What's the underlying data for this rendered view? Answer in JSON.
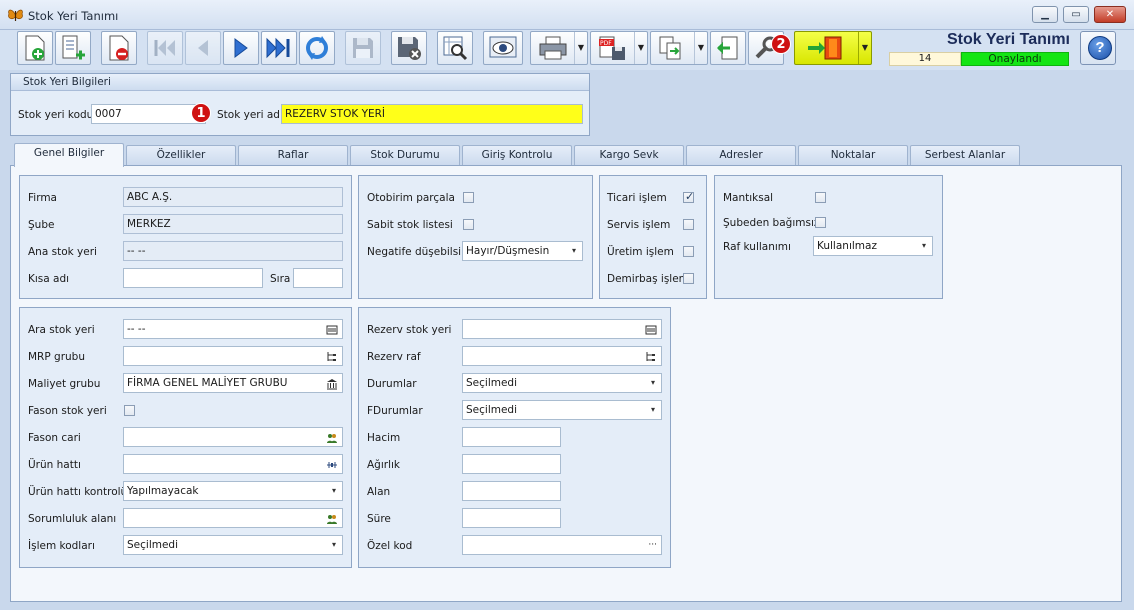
{
  "window": {
    "title": "Stok Yeri Tanımı"
  },
  "header": {
    "heading": "Stok Yeri Tanımı",
    "record_number": "14",
    "status": "Onaylandı",
    "status_color": "#14e514",
    "badges": [
      "1",
      "2"
    ]
  },
  "toolbar": {
    "buttons": [
      "new-document-icon",
      "new-list-icon",
      "delete-document-icon",
      "first-record-icon",
      "previous-record-icon",
      "next-record-icon",
      "last-record-icon",
      "refresh-icon",
      "save-icon",
      "save-cancel-icon",
      "search-icon",
      "preview-icon",
      "print-icon",
      "pdf-export-icon",
      "copy-icon",
      "back-icon",
      "tools-icon",
      "exit-icon"
    ]
  },
  "stock_header": {
    "panel_title": "Stok Yeri Bilgileri",
    "code_label": "Stok yeri kodu",
    "code_value": "0007",
    "name_label": "Stok yeri adı",
    "name_value": "REZERV STOK YERİ"
  },
  "tabs": [
    "Genel Bilgiler",
    "Özellikler",
    "Raflar",
    "Stok Durumu",
    "Giriş Kontrolu",
    "Kargo Sevk",
    "Adresler",
    "Noktalar",
    "Serbest Alanlar"
  ],
  "general": {
    "firma_label": "Firma",
    "firma_value": "ABC A.Ş.",
    "sube_label": "Şube",
    "sube_value": "MERKEZ",
    "ana_stok_label": "Ana stok yeri",
    "ana_stok_value": "-- --",
    "kisa_adi_label": "Kısa adı",
    "kisa_adi_value": "",
    "sira_label": "Sıra",
    "sira_value": ""
  },
  "options": {
    "otobirim_label": "Otobirim parçala",
    "sabit_label": "Sabit stok listesi",
    "negatife_label": "Negatife düşebilsin",
    "negatife_value": "Hayır/Düşmesin"
  },
  "types": {
    "ticari_label": "Ticari işlem",
    "ticari_checked": true,
    "servis_label": "Servis işlem",
    "servis_checked": false,
    "uretim_label": "Üretim işlem",
    "uretim_checked": false,
    "demirbas_label": "Demirbaş işlem",
    "demirbas_checked": false
  },
  "logic": {
    "mantiksal_label": "Mantıksal",
    "subeden_label": "Şubeden bağımsız",
    "raf_label": "Raf kullanımı",
    "raf_value": "Kullanılmaz"
  },
  "details": {
    "ara_stok_label": "Ara stok yeri",
    "ara_stok_value": "-- --",
    "mrp_label": "MRP grubu",
    "mrp_value": "",
    "maliyet_label": "Maliyet grubu",
    "maliyet_value": "FİRMA GENEL MALİYET GRUBU",
    "fason_stok_label": "Fason stok yeri",
    "fason_cari_label": "Fason cari",
    "fason_cari_value": "",
    "urun_hatti_label": "Ürün hattı",
    "urun_hatti_value": "",
    "urun_kontrol_label": "Ürün hattı kontrolü",
    "urun_kontrol_value": "Yapılmayacak",
    "sorumluluk_label": "Sorumluluk alanı",
    "sorumluluk_value": "",
    "islem_label": "İşlem kodları",
    "islem_value": "Seçilmedi"
  },
  "reserve": {
    "rezerv_stok_label": "Rezerv stok yeri",
    "rezerv_stok_value": "",
    "rezerv_raf_label": "Rezerv raf",
    "rezerv_raf_value": "",
    "durumlar_label": "Durumlar",
    "durumlar_value": "Seçilmedi",
    "fdurumlar_label": "FDurumlar",
    "fdurumlar_value": "Seçilmedi",
    "hacim_label": "Hacim",
    "agirlik_label": "Ağırlık",
    "alan_label": "Alan",
    "sure_label": "Süre",
    "ozel_kod_label": "Özel kod",
    "ellipsis": "···"
  }
}
